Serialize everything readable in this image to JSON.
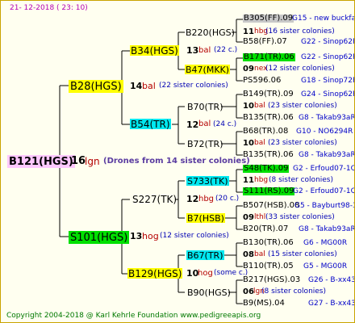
{
  "date": "21- 12-2018 ( 23: 10)",
  "copyright": "Copyright 2004-2018 @ Karl Kehrle Foundation    www.pedigreeapis.org",
  "root": {
    "name": "B121(HGS)",
    "num": "16",
    "label": "lgn",
    "sisters": "(Drones from 14 sister colonies)"
  },
  "gen1": [
    {
      "name": "B28(HGS)",
      "num": "14",
      "label": "bal",
      "sisters": "(22 sister colonies)"
    },
    {
      "name": "S101(HGS)",
      "num": "13",
      "label": "hog",
      "sisters": "(12 sister colonies)"
    }
  ],
  "gen2": [
    {
      "name": "B34(HGS)",
      "num": "13",
      "label": "bal",
      "sisters": "(22 c.)"
    },
    {
      "name": "B54(TR)",
      "num": "12",
      "label": "bal",
      "sisters": "(24 c.)"
    },
    {
      "name": "S227(TK)",
      "num": "12",
      "label": "hbg",
      "sisters": "(20 c.)"
    },
    {
      "name": "B129(HGS)",
      "num": "10",
      "label": "hog",
      "sisters": "(some c.)"
    }
  ],
  "gen3": [
    {
      "name": "B220(HGS)",
      "num": "11",
      "label": "hbg",
      "sisters": "(16 sister colonies)"
    },
    {
      "name": "B47(MKK)",
      "num": "09",
      "label": "nex",
      "sisters": "(12 sister colonies)"
    },
    {
      "name": "B70(TR)",
      "num": "10",
      "label": "bal",
      "sisters": "(23 sister colonies)"
    },
    {
      "name": "B72(TR)",
      "num": "10",
      "label": "bal",
      "sisters": "(23 sister colonies)"
    },
    {
      "name": "S733(TK)",
      "num": "11",
      "label": "hbg",
      "sisters": "(8 sister colonies)"
    },
    {
      "name": "B7(HSB)",
      "num": "09",
      "label": "lthl",
      "sisters": "(33 sister colonies)"
    },
    {
      "name": "B67(TR)",
      "num": "08",
      "label": "bal",
      "sisters": "(15 sister colonies)"
    },
    {
      "name": "B90(HGS)",
      "num": "06",
      "label": "lgn",
      "sisters": "(8 sister colonies)"
    }
  ],
  "gen4": [
    {
      "name": "B305(FF).09",
      "code": "G15 - new buckfas"
    },
    {
      "name": "B58(FF).07",
      "code": "G22 - Sinop62R"
    },
    {
      "name": "B171(TR).06",
      "code": "G22 - Sinop62R"
    },
    {
      "name": "PS596.06",
      "code": "G18 - Sinop72R"
    },
    {
      "name": "B149(TR).09",
      "code": "G24 - Sinop62R"
    },
    {
      "name": "B135(TR).06",
      "code": "G8 - Takab93aR"
    },
    {
      "name": "B68(TR).08",
      "code": "G10 - NO6294R"
    },
    {
      "name": "B135(TR).06",
      "code": "G8 - Takab93aR"
    },
    {
      "name": "S48(TK).09",
      "code": "G2 - Erfoud07-1Q"
    },
    {
      "name": "S111(RS).09",
      "code": "G2 - Erfoud07-1Q"
    },
    {
      "name": "B507(HSB).08",
      "code": "G5 - Bayburt98-3"
    },
    {
      "name": "B20(TR).07",
      "code": "G8 - Takab93aR"
    },
    {
      "name": "B130(TR).06",
      "code": "G6 - MG00R"
    },
    {
      "name": "B110(TR).05",
      "code": "G5 - MG00R"
    },
    {
      "name": "B217(HGS).03",
      "code": "G26 - B-xx43"
    },
    {
      "name": "B9(MS).04",
      "code": "G27 - B-xx43"
    }
  ]
}
